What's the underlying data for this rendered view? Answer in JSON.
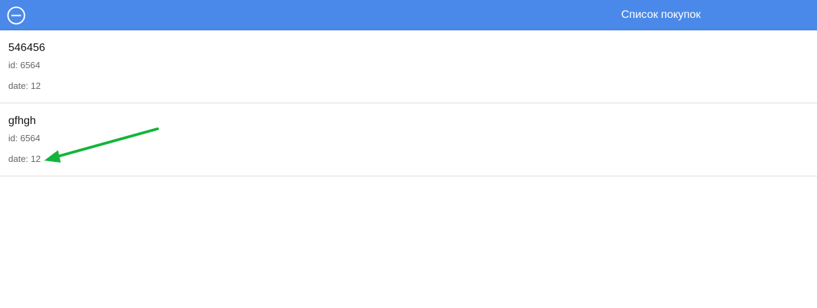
{
  "header": {
    "title": "Список покупок",
    "icon": "minus-circle-icon"
  },
  "purchases": [
    {
      "name": "546456",
      "id_text": "id: 6564",
      "date_text": "date: 12"
    },
    {
      "name": "gfhgh",
      "id_text": "id: 6564",
      "date_text": "date: 12"
    }
  ],
  "annotation": {
    "color": "#12b53a",
    "points_to": "date field of second item"
  }
}
